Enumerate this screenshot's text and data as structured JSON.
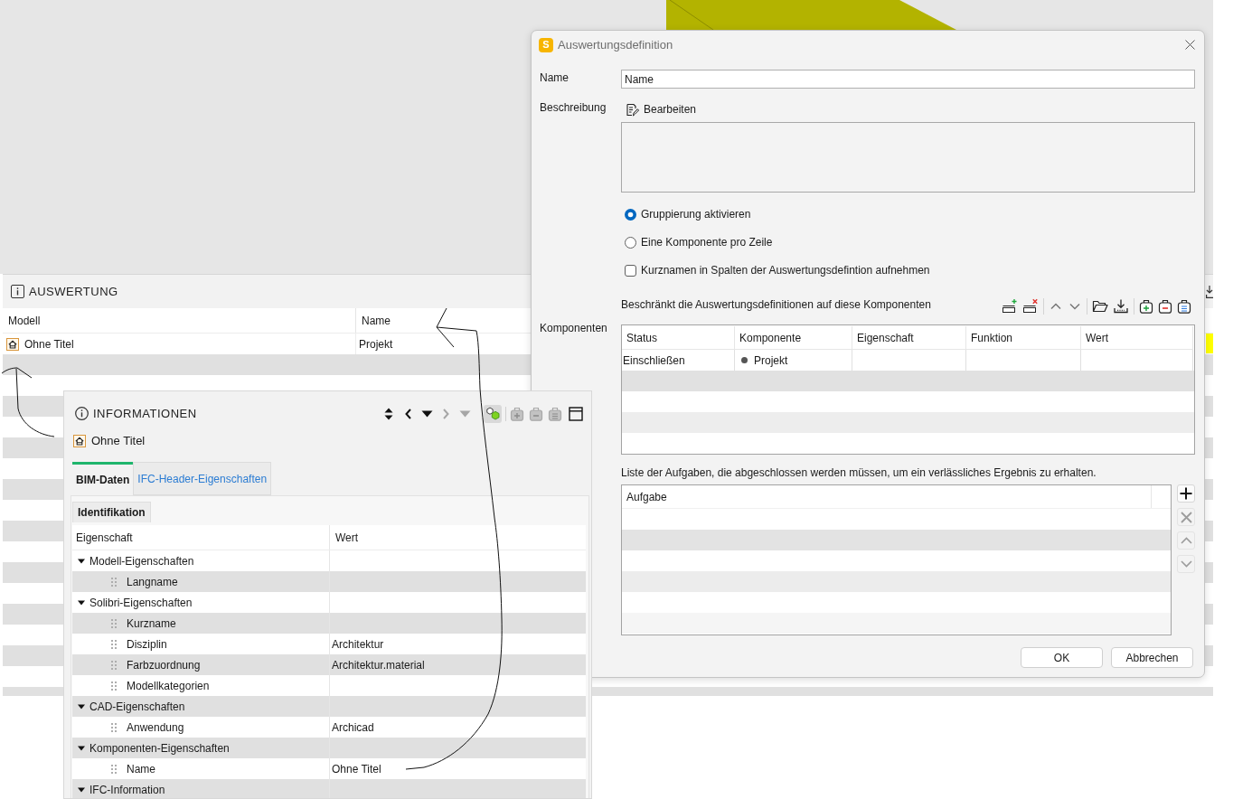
{
  "auswertung": {
    "title": "AUSWERTUNG",
    "columns": [
      "Modell",
      "Name"
    ],
    "rows": [
      {
        "modell": "Ohne Titel",
        "name": "Projekt"
      }
    ]
  },
  "informationen": {
    "title": "INFORMATIONEN",
    "toolbar": [
      {
        "disabled": false,
        "on": false
      },
      {
        "disabled": false,
        "on": false
      },
      {
        "disabled": false,
        "on": false
      },
      {
        "disabled": true,
        "on": false
      },
      {
        "disabled": true,
        "on": false
      },
      {
        "disabled": false,
        "on": true
      },
      {
        "disabled": true,
        "on": false
      },
      {
        "disabled": true,
        "on": false
      },
      {
        "disabled": true,
        "on": false
      },
      {
        "disabled": false,
        "on": false
      }
    ],
    "model": "Ohne Titel",
    "tabs": [
      {
        "label": "BIM-Daten",
        "selected": true
      },
      {
        "label": "IFC-Header-Eigenschaften",
        "selected": false
      }
    ],
    "subtabs": [
      {
        "label": "Identifikation",
        "selected": true
      }
    ],
    "columns": [
      "Eigenschaft",
      "Wert"
    ],
    "tree": [
      {
        "label": "Modell-Eigenschaften",
        "expanded": true,
        "children": [
          {
            "label": "Langname"
          }
        ]
      },
      {
        "label": "Solibri-Eigenschaften",
        "expanded": true,
        "children": [
          {
            "label": "Kurzname"
          },
          {
            "label": "Disziplin",
            "value": "Architektur"
          },
          {
            "label": "Farbzuordnung",
            "value": "Architektur.material"
          },
          {
            "label": "Modellkategorien"
          }
        ]
      },
      {
        "label": "CAD-Eigenschaften",
        "expanded": true,
        "children": [
          {
            "label": "Anwendung",
            "value": "Archicad"
          }
        ]
      },
      {
        "label": "Komponenten-Eigenschaften",
        "expanded": true,
        "children": [
          {
            "label": "Name",
            "value": "Ohne Titel"
          }
        ]
      },
      {
        "label": "IFC-Information",
        "expanded": true
      }
    ]
  },
  "dialog": {
    "logo": "S",
    "title": "Auswertungsdefinition",
    "name_label": "Name",
    "name_value": "Name",
    "description_label": "Beschreibung",
    "edit_label": "Bearbeiten",
    "options": [
      {
        "kind": "radio",
        "label": "Gruppierung aktivieren",
        "selected": true
      },
      {
        "kind": "radio",
        "label": "Eine Komponente pro Zeile",
        "selected": false
      },
      {
        "kind": "checkbox",
        "label": "Kurznamen in Spalten der Auswertungsdefintion aufnehmen",
        "checked": false
      }
    ],
    "components_caption": "Beschränkt die Auswertungsdefinitionen auf diese Komponenten",
    "components_label": "Komponenten",
    "components_columns": [
      "Status",
      "Komponente",
      "Eigenschaft",
      "Funktion",
      "Wert"
    ],
    "components_rows": [
      {
        "status": "Einschließen",
        "component": "Projekt"
      }
    ],
    "tasks_caption": "Liste der Aufgaben, die abgeschlossen werden müssen, um ein verlässliches Ergebnis zu erhalten.",
    "tasks_columns": [
      "Aufgabe"
    ],
    "task_buttons": [
      {
        "disabled": false
      },
      {
        "disabled": true
      },
      {
        "disabled": true
      },
      {
        "disabled": true
      }
    ],
    "buttons": [
      "OK",
      "Abbrechen"
    ]
  }
}
